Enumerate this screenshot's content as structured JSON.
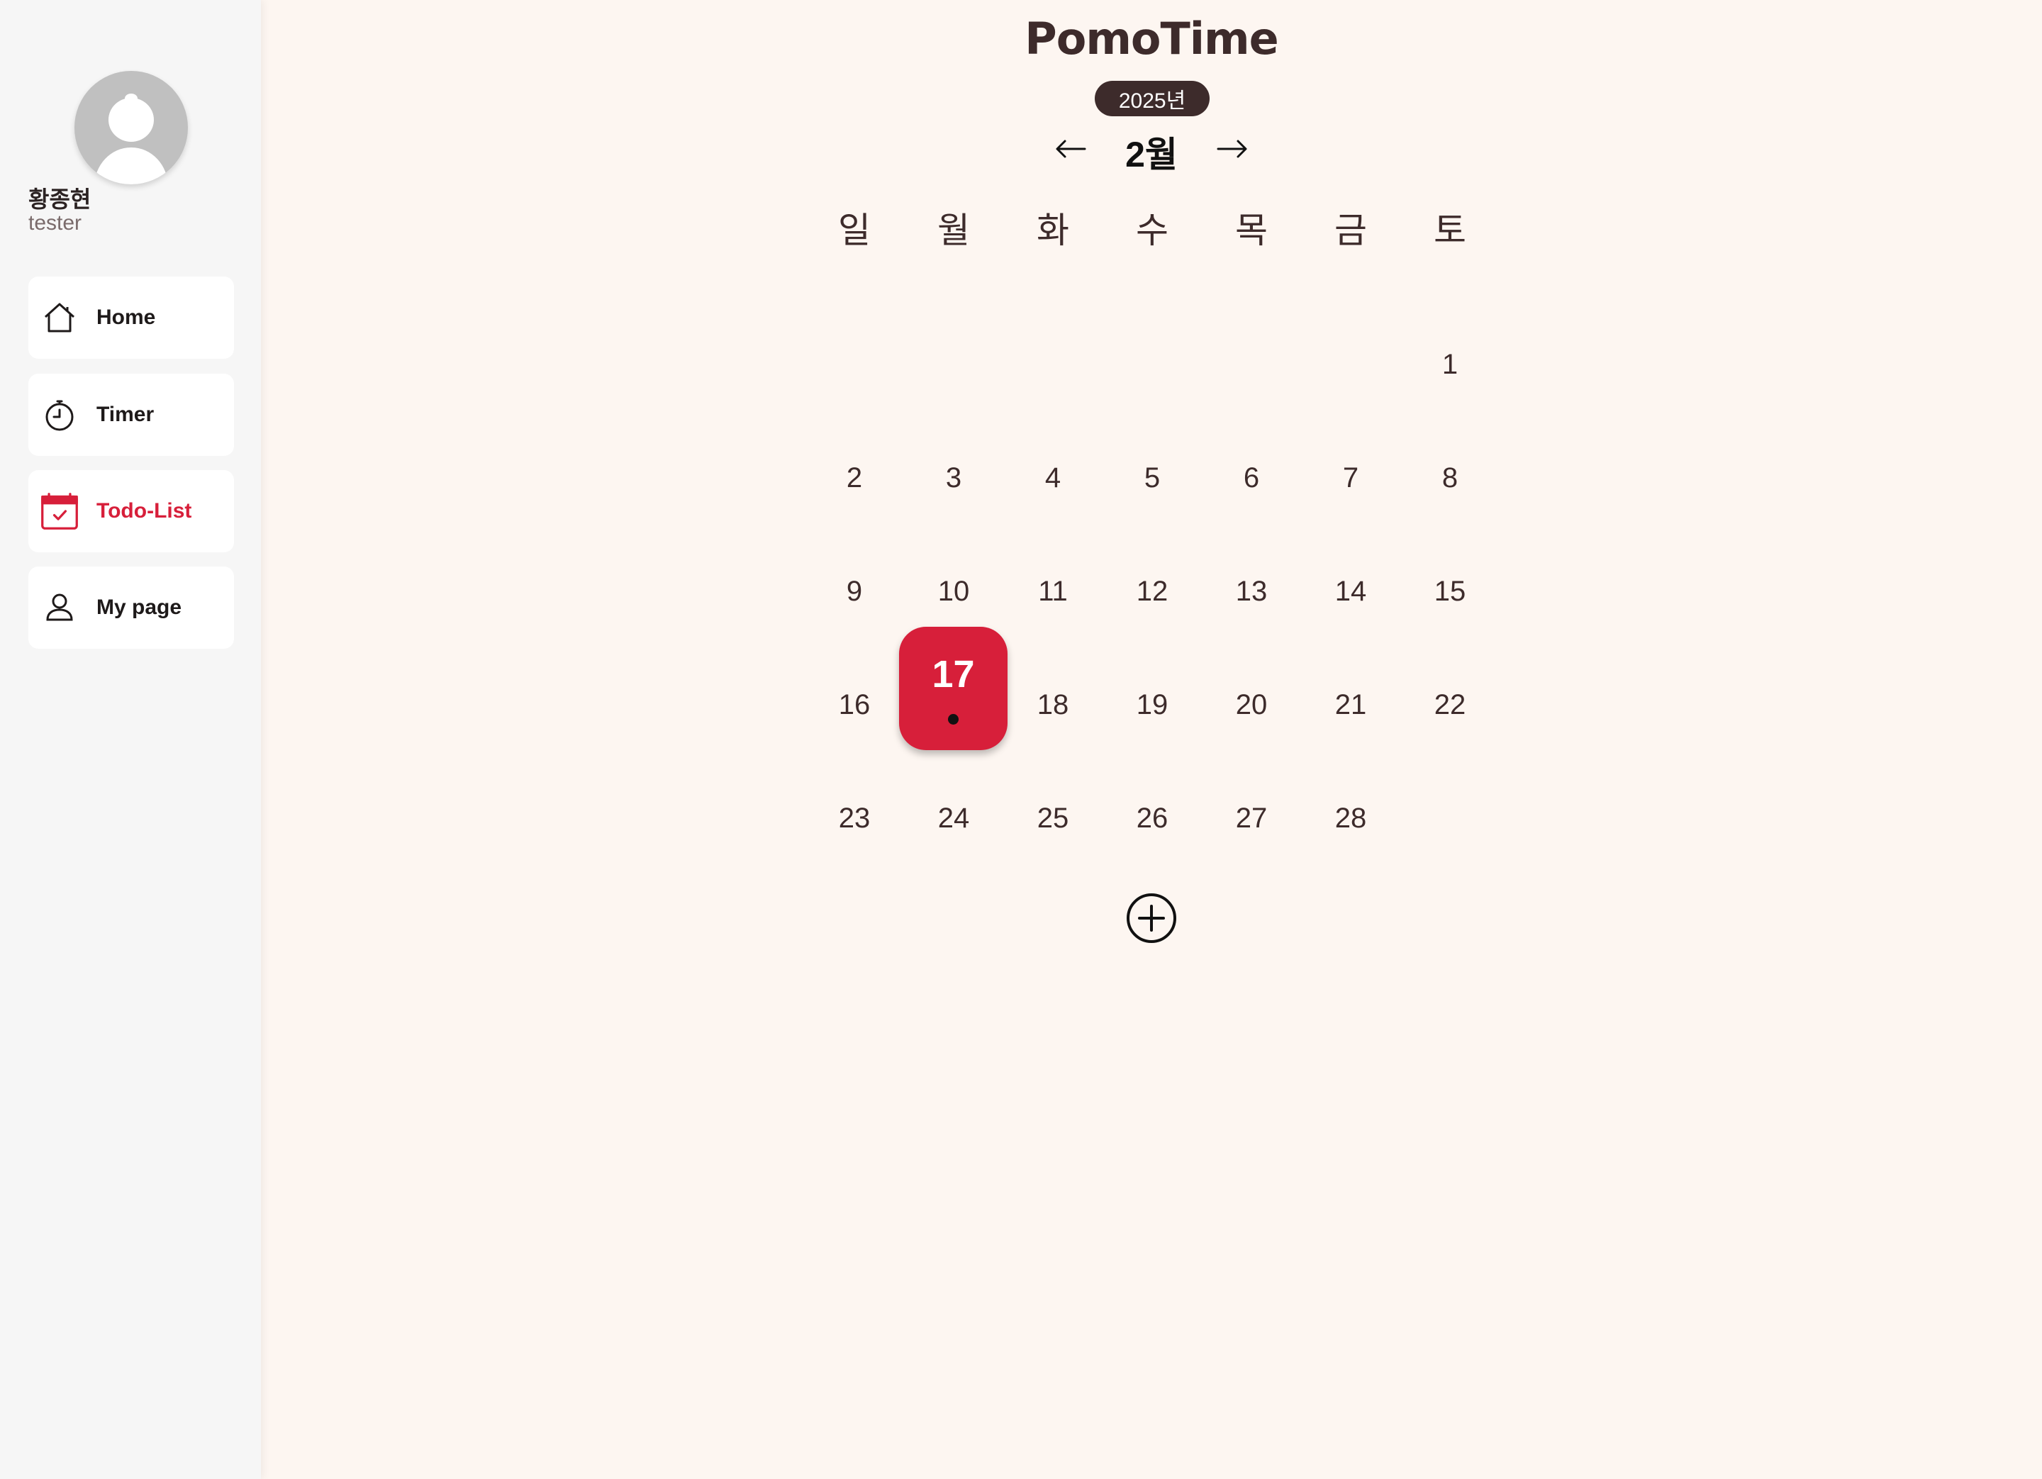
{
  "sidebar": {
    "user_name": "황종현",
    "user_role": "tester",
    "items": [
      {
        "label": "Home",
        "icon": "home-icon"
      },
      {
        "label": "Timer",
        "icon": "stopwatch-icon"
      },
      {
        "label": "Todo-List",
        "icon": "calendar-check-icon",
        "active": true
      },
      {
        "label": "My page",
        "icon": "user-icon"
      }
    ]
  },
  "header": {
    "app_title": "PomoTime",
    "year": "2025년",
    "month": "2월",
    "prev_icon": "arrow-left-icon",
    "next_icon": "arrow-right-icon"
  },
  "calendar": {
    "weekdays": [
      "일",
      "월",
      "화",
      "수",
      "목",
      "금",
      "토"
    ],
    "weeks": [
      [
        "",
        "",
        "",
        "",
        "",
        "",
        "1"
      ],
      [
        "2",
        "3",
        "4",
        "5",
        "6",
        "7",
        "8"
      ],
      [
        "9",
        "10",
        "11",
        "12",
        "13",
        "14",
        "15"
      ],
      [
        "16",
        "17",
        "18",
        "19",
        "20",
        "21",
        "22"
      ],
      [
        "23",
        "24",
        "25",
        "26",
        "27",
        "28",
        ""
      ]
    ],
    "selected_day": "17",
    "selected_has_event": true
  },
  "add_icon": "plus-circle-icon",
  "colors": {
    "accent": "#d71f3a",
    "dark_brown": "#3d2b2b",
    "background": "#fdf6f1",
    "sidebar": "#f6f6f6"
  }
}
